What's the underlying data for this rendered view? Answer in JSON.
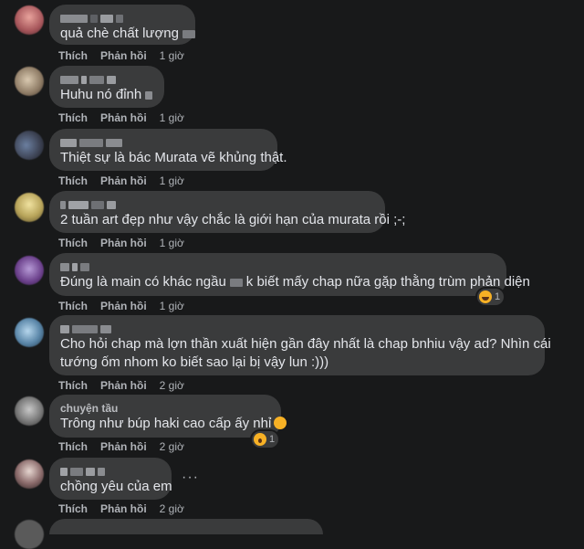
{
  "labels": {
    "like": "Thích",
    "reply": "Phản hồi"
  },
  "comments": [
    {
      "text": "quả chè chất lượng",
      "time": "1 giờ"
    },
    {
      "text": "Huhu nó đỉnh",
      "time": "1 giờ"
    },
    {
      "text": "Thiệt sự là bác Murata vẽ khủng thật.",
      "time": "1 giờ"
    },
    {
      "text": "2 tuần art đẹp như vậy chắc là giới hạn của murata rồi ;-;",
      "time": "1 giờ"
    },
    {
      "text_a": "Đúng là main có khác ngầu",
      "text_b": "k biết mấy chap nữa gặp thằng trùm phản diện",
      "time": "1 giờ",
      "reaction_count": "1"
    },
    {
      "text_line1": "Cho hỏi chap mà lợn thần xuất hiện gần đây nhất là chap bnhiu vậy ad? Nhìn cái",
      "text_line2": "tướng ốm nhom ko biết sao lại bị vậy lun :)))",
      "time": "2 giờ"
    },
    {
      "author": "chuyện tầu",
      "text": "Trông như búp haki cao cấp ấy nhỉ",
      "time": "2 giờ",
      "reaction_count": "1"
    },
    {
      "text": "chồng yêu của em",
      "time": "2 giờ",
      "more": "···"
    }
  ],
  "icons": {
    "reaction_laugh": "laugh-emoji-icon",
    "reaction_wow": "wow-emoji-icon",
    "more": "more-options-icon"
  }
}
